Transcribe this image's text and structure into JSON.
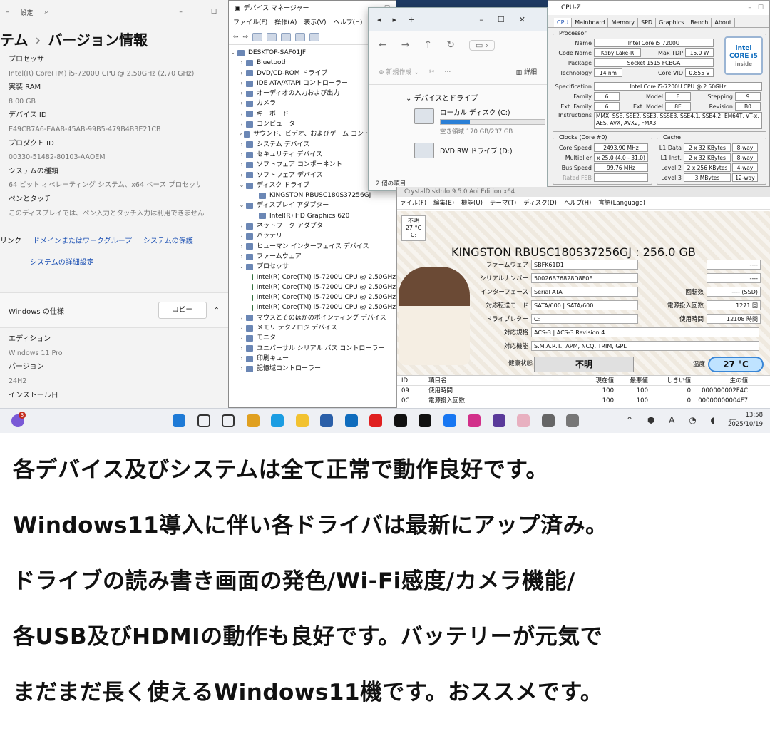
{
  "settings": {
    "app_label": "設定",
    "breadcrumb_parent": "テム",
    "breadcrumb_current": "バージョン情報",
    "specs": [
      {
        "k": "プロセッサ",
        "v": "Intel(R) Core(TM) i5-7200U CPU @ 2.50GHz (2.70 GHz)"
      },
      {
        "k": "実装 RAM",
        "v": "8.00 GB"
      },
      {
        "k": "デバイス ID",
        "v": "E49CB7A6-EAAB-45AB-99B5-479B4B3E21CB"
      },
      {
        "k": "プロダクト ID",
        "v": "00330-51482-80103-AAOEM"
      },
      {
        "k": "システムの種類",
        "v": "64 ビット オペレーティング システム、x64 ベース プロセッサ"
      },
      {
        "k": "ペンとタッチ",
        "v": "このディスプレイでは、ペン入力とタッチ入力は利用できません"
      }
    ],
    "links_label": "リンク",
    "links": [
      "ドメインまたはワークグループ",
      "システムの保護"
    ],
    "advanced_link": "システムの詳細設定",
    "winspec_title": "Windows の仕様",
    "copy_button": "コピー",
    "winspecs": [
      {
        "k": "エディション",
        "v": "Windows 11 Pro"
      },
      {
        "k": "バージョン",
        "v": "24H2"
      },
      {
        "k": "インストール日",
        "v": ""
      }
    ]
  },
  "devmgr": {
    "title": "デバイス マネージャー",
    "menu": [
      "ファイル(F)",
      "操作(A)",
      "表示(V)",
      "ヘルプ(H)"
    ],
    "root": "DESKTOP-SAF01JF",
    "items": [
      {
        "t": "Bluetooth",
        "ex": "›",
        "lvl": 1
      },
      {
        "t": "DVD/CD-ROM ドライブ",
        "ex": "›",
        "lvl": 1
      },
      {
        "t": "IDE ATA/ATAPI コントローラー",
        "ex": "›",
        "lvl": 1
      },
      {
        "t": "オーディオの入力および出力",
        "ex": "›",
        "lvl": 1
      },
      {
        "t": "カメラ",
        "ex": "›",
        "lvl": 1
      },
      {
        "t": "キーボード",
        "ex": "›",
        "lvl": 1
      },
      {
        "t": "コンピューター",
        "ex": "›",
        "lvl": 1
      },
      {
        "t": "サウンド、ビデオ、およびゲーム コントローラー",
        "ex": "›",
        "lvl": 1
      },
      {
        "t": "システム デバイス",
        "ex": "›",
        "lvl": 1
      },
      {
        "t": "セキュリティ デバイス",
        "ex": "›",
        "lvl": 1
      },
      {
        "t": "ソフトウェア コンポーネント",
        "ex": "›",
        "lvl": 1
      },
      {
        "t": "ソフトウェア デバイス",
        "ex": "›",
        "lvl": 1
      },
      {
        "t": "ディスク ドライブ",
        "ex": "⌄",
        "lvl": 1
      },
      {
        "t": "KINGSTON RBUSC180S37256GJ",
        "ex": "",
        "lvl": 2
      },
      {
        "t": "ディスプレイ アダプター",
        "ex": "⌄",
        "lvl": 1
      },
      {
        "t": "Intel(R) HD Graphics 620",
        "ex": "",
        "lvl": 2
      },
      {
        "t": "ネットワーク アダプター",
        "ex": "›",
        "lvl": 1
      },
      {
        "t": "バッテリ",
        "ex": "›",
        "lvl": 1
      },
      {
        "t": "ヒューマン インターフェイス デバイス",
        "ex": "›",
        "lvl": 1
      },
      {
        "t": "ファームウェア",
        "ex": "›",
        "lvl": 1
      },
      {
        "t": "プロセッサ",
        "ex": "⌄",
        "lvl": 1
      },
      {
        "t": "Intel(R) Core(TM) i5-7200U CPU @ 2.50GHz",
        "ex": "",
        "lvl": 2
      },
      {
        "t": "Intel(R) Core(TM) i5-7200U CPU @ 2.50GHz",
        "ex": "",
        "lvl": 2
      },
      {
        "t": "Intel(R) Core(TM) i5-7200U CPU @ 2.50GHz",
        "ex": "",
        "lvl": 2
      },
      {
        "t": "Intel(R) Core(TM) i5-7200U CPU @ 2.50GHz",
        "ex": "",
        "lvl": 2
      },
      {
        "t": "マウスとそのほかのポインティング デバイス",
        "ex": "›",
        "lvl": 1
      },
      {
        "t": "メモリ テクノロジ デバイス",
        "ex": "›",
        "lvl": 1
      },
      {
        "t": "モニター",
        "ex": "›",
        "lvl": 1
      },
      {
        "t": "ユニバーサル シリアル バス コントローラー",
        "ex": "›",
        "lvl": 1
      },
      {
        "t": "印刷キュー",
        "ex": "›",
        "lvl": 1
      },
      {
        "t": "記憶域コントローラー",
        "ex": "›",
        "lvl": 1
      }
    ]
  },
  "explorer": {
    "new_label": "新規作成",
    "details_label": "詳細",
    "section": "デバイスとドライブ",
    "drives": [
      {
        "name": "ローカル ディスク (C:)",
        "sub": "空き領域 170 GB/237 GB",
        "used": 0.28
      },
      {
        "name": "DVD RW ドライブ (D:)",
        "sub": "",
        "used": null
      }
    ],
    "status": "2 個の項目"
  },
  "cpuz": {
    "title": "CPU-Z",
    "tabs": [
      "CPU",
      "Mainboard",
      "Memory",
      "SPD",
      "Graphics",
      "Bench",
      "About"
    ],
    "processor_group": "Processor",
    "name": "Intel Core i5 7200U",
    "code_name": "Kaby Lake-R",
    "max_tdp": "15.0 W",
    "package": "Socket 1515 FCBGA",
    "technology": "14 nm",
    "core_vid": "0.855 V",
    "specification": "Intel Core i5-7200U CPU @ 2.50GHz",
    "family": "6",
    "model": "E",
    "stepping": "9",
    "ext_family": "6",
    "ext_model": "8E",
    "revision": "B0",
    "instructions": "MMX, SSE, SSE2, SSE3, SSSE3, SSE4.1, SSE4.2, EM64T, VT-x, AES, AVX, AVX2, FMA3",
    "clocks_group": "Clocks (Core #0)",
    "core_speed": "2493.90 MHz",
    "multiplier": "x 25.0 (4.0 - 31.0)",
    "bus_speed": "99.76 MHz",
    "rated_fsb": "Rated FSB",
    "cache_group": "Cache",
    "cache": [
      {
        "k": "L1 Data",
        "v": "2 x 32 KBytes",
        "w": "8-way"
      },
      {
        "k": "L1 Inst.",
        "v": "2 x 32 KBytes",
        "w": "8-way"
      },
      {
        "k": "Level 2",
        "v": "2 x 256 KBytes",
        "w": "4-way"
      },
      {
        "k": "Level 3",
        "v": "3 MBytes",
        "w": "12-way"
      }
    ],
    "logo_top": "intel",
    "logo_mid": "CORE i5",
    "logo_bot": "inside"
  },
  "cdi": {
    "title": "CrystalDiskInfo 9.5.0 Aoi Edition x64",
    "menu": [
      "ァイル(F)",
      "編集(E)",
      "機能(U)",
      "テーマ(T)",
      "ディスク(D)",
      "ヘルプ(H)",
      "言語(Language)"
    ],
    "chip_status": "不明",
    "chip_temp": "27 °C",
    "chip_drive": "C:",
    "model": "KINGSTON RBUSC180S37256GJ : 256.0 GB",
    "fields": [
      {
        "k": "ファームウェア",
        "v": "SBFK61D1"
      },
      {
        "k": "シリアルナンバー",
        "v": "50026B76828D8F0E"
      },
      {
        "k": "インターフェース",
        "v": "Serial ATA"
      },
      {
        "k": "対応転送モード",
        "v": "SATA/600 | SATA/600"
      },
      {
        "k": "ドライブレター",
        "v": "C:"
      },
      {
        "k": "対応規格",
        "v": "ACS-3 | ACS-3 Revision 4"
      },
      {
        "k": "対応機能",
        "v": "S.M.A.R.T., APM, NCQ, TRIM, GPL"
      }
    ],
    "right_fields": [
      {
        "k": "",
        "v": "----"
      },
      {
        "k": "",
        "v": "----"
      },
      {
        "k": "回転数",
        "v": "---- (SSD)"
      },
      {
        "k": "電源投入回数",
        "v": "1271 回"
      },
      {
        "k": "使用時間",
        "v": "12108 時間"
      }
    ],
    "health_label": "健康状態",
    "health_value": "不明",
    "temp_label": "温度",
    "temp_value": "27 °C",
    "smart_headers": [
      "ID",
      "項目名",
      "現在値",
      "最悪値",
      "しきい値",
      "生の値"
    ],
    "smart_rows": [
      {
        "id": "09",
        "name": "使用時間",
        "cur": "100",
        "worst": "100",
        "th": "0",
        "raw": "000000002F4C"
      },
      {
        "id": "0C",
        "name": "電源投入回数",
        "cur": "100",
        "worst": "100",
        "th": "0",
        "raw": "00000000004F7"
      }
    ]
  },
  "taskbar": {
    "badge": "3",
    "time": "13:58",
    "date": "2025/10/19",
    "ime": "A"
  },
  "caption": [
    "各デバイス及びシステムは全て正常で動作良好です。",
    "Windows11導入に伴い各ドライバは最新にアップ済み。",
    "ドライブの読み書き画面の発色/Wi-Fi感度/カメラ機能/",
    "各USB及びHDMIの動作も良好です。バッテリーが元気で",
    "まだまだ長く使えるWindows11機です。おススメです。"
  ]
}
